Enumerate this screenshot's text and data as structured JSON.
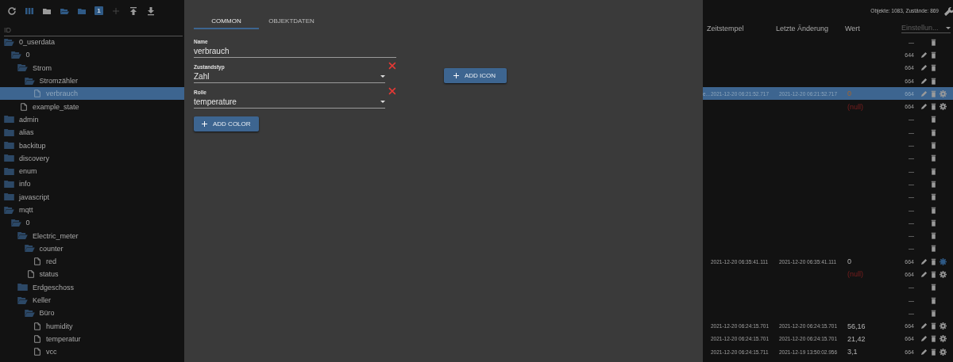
{
  "toolbar": {
    "badge": "1"
  },
  "filter": {
    "placeholder": "ID"
  },
  "status": "Objekte: 1083, Zustände: 869",
  "columns": [
    "Zeitstempel",
    "Letzte Änderung",
    "Wert"
  ],
  "settings_select": {
    "placeholder": "Einstellun..."
  },
  "tree": [
    {
      "name": "0_userdata",
      "kind": "folder",
      "expanded": true,
      "selected": false,
      "acl": "—",
      "editable": false,
      "settings": false,
      "children": [
        {
          "name": "0",
          "kind": "folder",
          "expanded": true,
          "selected": false,
          "acl": "644",
          "editable": true,
          "settings": false,
          "children": [
            {
              "name": "Strom",
              "kind": "folder",
              "expanded": true,
              "selected": false,
              "acl": "664",
              "editable": true,
              "settings": false,
              "children": [
                {
                  "name": "Stromzähler",
                  "kind": "folder",
                  "expanded": true,
                  "selected": false,
                  "acl": "664",
                  "editable": true,
                  "settings": false,
                  "children": [
                    {
                      "name": "verbrauch",
                      "kind": "file",
                      "selected": true,
                      "column_1": "e...",
                      "timestamp": "2021-12-20 06:21:52.717",
                      "last_change": "2021-12-20 06:21:52.717",
                      "value": "0",
                      "null": false,
                      "ack": false,
                      "acl": "664",
                      "editable": true,
                      "settings": true,
                      "custom_settings": false
                    }
                  ]
                }
              ]
            },
            {
              "name": "example_state",
              "kind": "file",
              "selected": false,
              "value": "(null)",
              "null": true,
              "acl": "664",
              "editable": true,
              "settings": true,
              "custom_settings": false
            }
          ]
        }
      ]
    },
    {
      "name": "admin",
      "kind": "folder",
      "expanded": false,
      "selected": false,
      "acl": "—",
      "editable": false,
      "settings": false
    },
    {
      "name": "alias",
      "kind": "folder",
      "expanded": false,
      "selected": false,
      "acl": "—",
      "editable": false,
      "settings": false
    },
    {
      "name": "backitup",
      "kind": "folder",
      "expanded": false,
      "selected": false,
      "acl": "—",
      "editable": false,
      "settings": false
    },
    {
      "name": "discovery",
      "kind": "folder",
      "expanded": false,
      "selected": false,
      "acl": "—",
      "editable": false,
      "settings": false
    },
    {
      "name": "enum",
      "kind": "folder",
      "expanded": false,
      "selected": false,
      "acl": "—",
      "editable": false,
      "settings": false
    },
    {
      "name": "info",
      "kind": "folder",
      "expanded": false,
      "selected": false,
      "acl": "—",
      "editable": false,
      "settings": false
    },
    {
      "name": "javascript",
      "kind": "folder",
      "expanded": false,
      "selected": false,
      "acl": "—",
      "editable": false,
      "settings": false
    },
    {
      "name": "mqtt",
      "kind": "folder",
      "expanded": true,
      "selected": false,
      "acl": "—",
      "editable": false,
      "settings": false,
      "children": [
        {
          "name": "0",
          "kind": "folder",
          "expanded": true,
          "selected": false,
          "acl": "—",
          "editable": false,
          "settings": false,
          "children": [
            {
              "name": "Electric_meter",
              "kind": "folder",
              "expanded": true,
              "selected": false,
              "acl": "—",
              "editable": false,
              "settings": false,
              "children": [
                {
                  "name": "counter",
                  "kind": "folder",
                  "expanded": true,
                  "selected": false,
                  "acl": "—",
                  "editable": false,
                  "settings": false,
                  "children": [
                    {
                      "name": "red",
                      "kind": "file",
                      "selected": false,
                      "timestamp": "2021-12-20 06:35:41.111",
                      "last_change": "2021-12-20 06:35:41.111",
                      "value": "0",
                      "null": false,
                      "ack": true,
                      "acl": "664",
                      "editable": true,
                      "settings": true,
                      "custom_settings": true
                    }
                  ]
                },
                {
                  "name": "status",
                  "kind": "file",
                  "selected": false,
                  "value": "(null)",
                  "null": true,
                  "acl": "664",
                  "editable": true,
                  "settings": true,
                  "custom_settings": false
                }
              ]
            },
            {
              "name": "Erdgeschoss",
              "kind": "folder",
              "expanded": false,
              "selected": false,
              "acl": "—",
              "editable": false,
              "settings": false
            },
            {
              "name": "Keller",
              "kind": "folder",
              "expanded": true,
              "selected": false,
              "acl": "—",
              "editable": false,
              "settings": false,
              "children": [
                {
                  "name": "Büro",
                  "kind": "folder",
                  "expanded": true,
                  "selected": false,
                  "acl": "—",
                  "editable": false,
                  "settings": false,
                  "children": [
                    {
                      "name": "humidity",
                      "kind": "file",
                      "selected": false,
                      "timestamp": "2021-12-20 06:24:15.701",
                      "last_change": "2021-12-20 06:24:15.701",
                      "value": "56,16",
                      "null": false,
                      "ack": true,
                      "acl": "664",
                      "editable": true,
                      "settings": true,
                      "custom_settings": false
                    },
                    {
                      "name": "temperatur",
                      "kind": "file",
                      "selected": false,
                      "timestamp": "2021-12-20 06:24:15.701",
                      "last_change": "2021-12-20 06:24:15.701",
                      "value": "21,42",
                      "null": false,
                      "ack": true,
                      "acl": "664",
                      "editable": true,
                      "settings": true,
                      "custom_settings": false
                    },
                    {
                      "name": "vcc",
                      "kind": "file",
                      "selected": false,
                      "timestamp": "2021-12-20 06:24:15.711",
                      "last_change": "2021-12-19 13:50:02.956",
                      "value": "3,1",
                      "null": false,
                      "ack": true,
                      "acl": "664",
                      "editable": true,
                      "settings": true,
                      "custom_settings": false
                    }
                  ]
                }
              ]
            }
          ]
        }
      ]
    }
  ],
  "dialog": {
    "tabs": [
      {
        "label": "COMMON",
        "selected": true
      },
      {
        "label": "OBJEKTDATEN",
        "selected": false
      }
    ],
    "fields": [
      {
        "kind": "text",
        "label": "Name",
        "value": "verbrauch"
      },
      {
        "kind": "select",
        "label": "Zustandstyp",
        "value": "Zahl",
        "clearable": true
      },
      {
        "kind": "select",
        "label": "Rolle",
        "value": "temperature",
        "clearable": true
      }
    ],
    "add_color": "ADD COLOR",
    "add_icon": "ADD ICON"
  }
}
